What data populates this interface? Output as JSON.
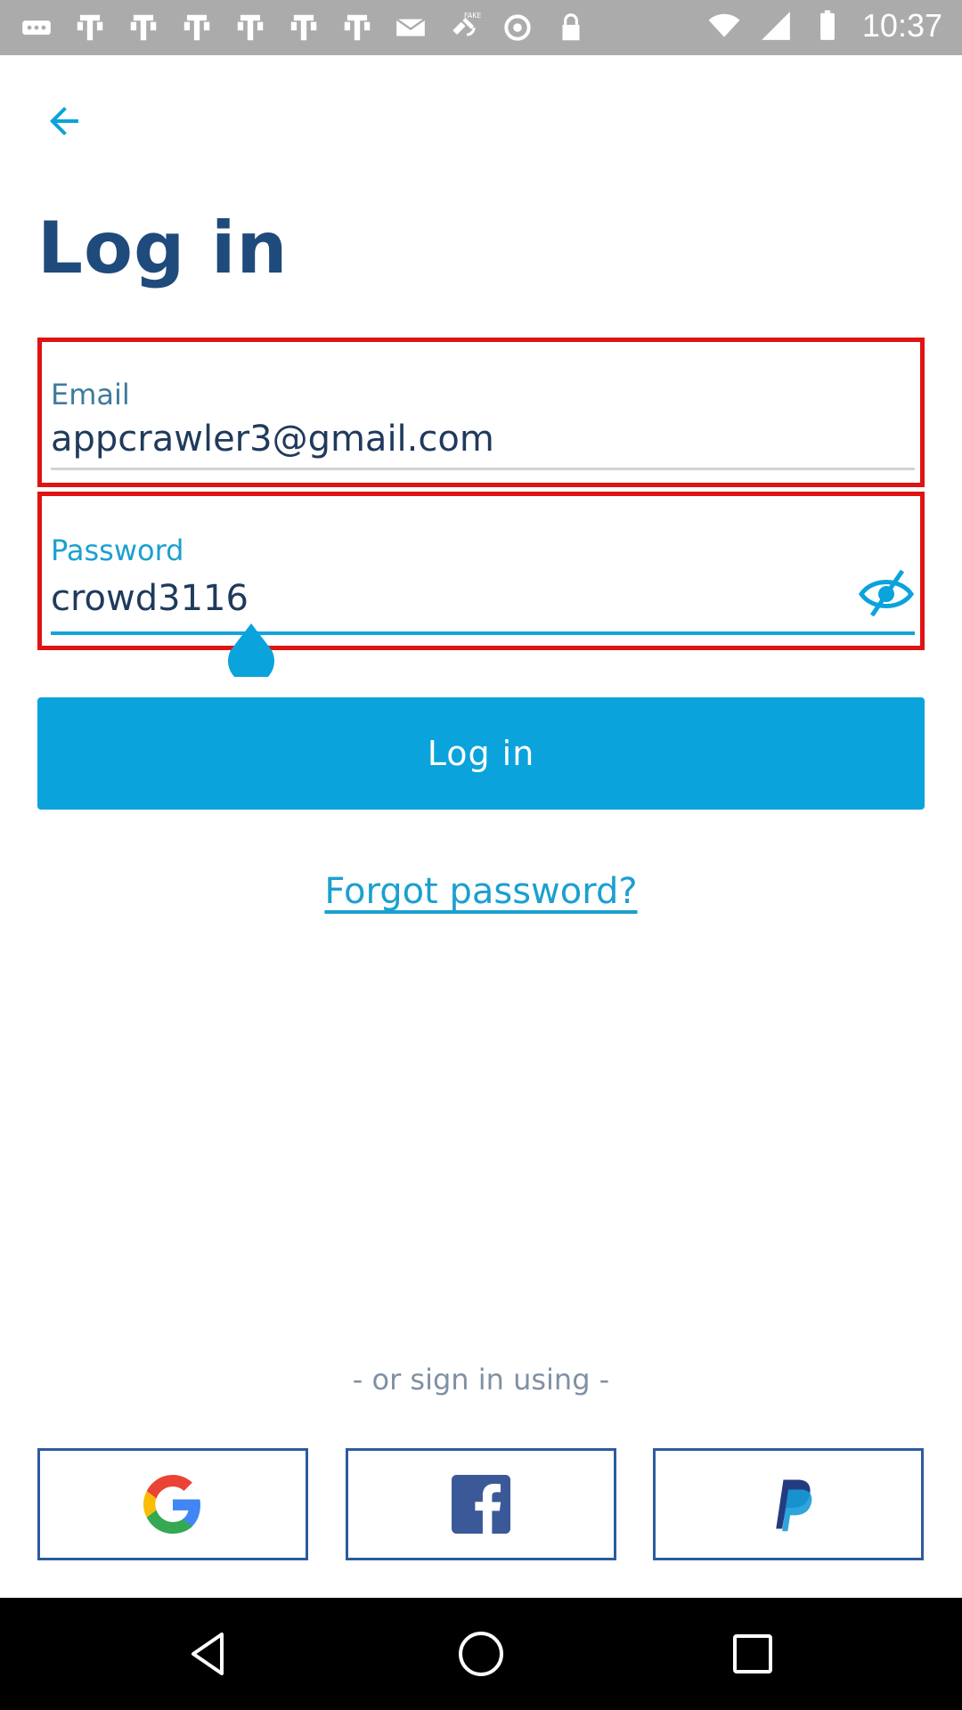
{
  "status_bar": {
    "time": "10:37",
    "left_icons": [
      "more-icon",
      "notification-icon",
      "notification-icon",
      "notification-icon",
      "notification-icon",
      "notification-icon",
      "notification-icon",
      "mail-icon",
      "fake-gps-icon",
      "sync-icon",
      "lock-icon"
    ],
    "fake_label": "FAKE"
  },
  "page": {
    "title": "Log in"
  },
  "email": {
    "label": "Email",
    "value": "appcrawler3@gmail.com"
  },
  "password": {
    "label": "Password",
    "value": "crowd3116"
  },
  "login_button": {
    "label": "Log in"
  },
  "forgot_password": {
    "label": "Forgot password?"
  },
  "social": {
    "divider_text": "- or sign in using -",
    "providers": [
      "google",
      "facebook",
      "paypal"
    ]
  },
  "colors": {
    "title": "#1f4a7c",
    "accent": "#0aa3dc",
    "error_outline": "#e01313",
    "social_border": "#2c5ba0"
  }
}
